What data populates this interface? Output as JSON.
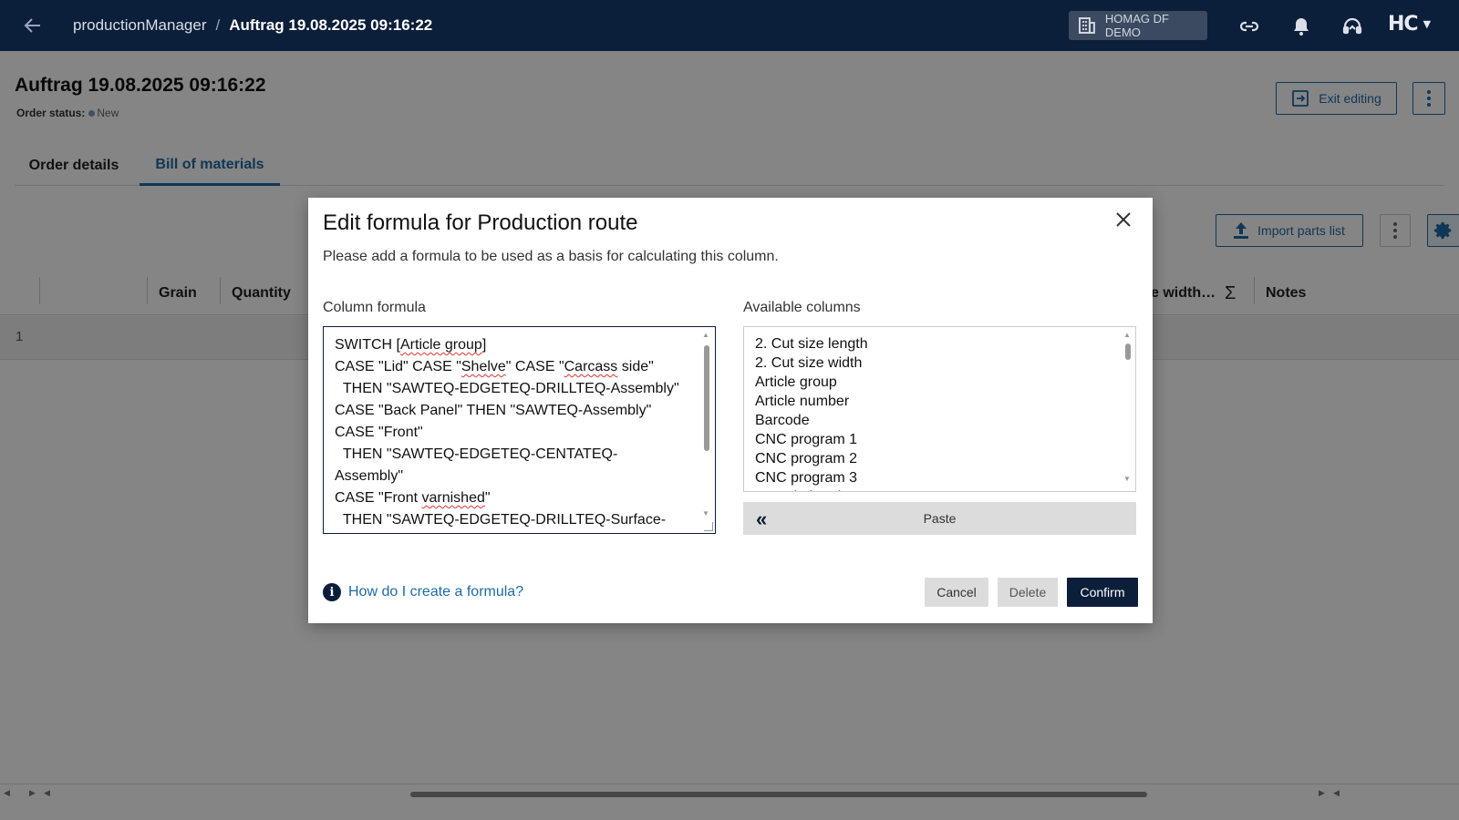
{
  "topbar": {
    "app_name": "productionManager",
    "separator": "/",
    "current": "Auftrag 19.08.2025 09:16:22",
    "tenant": "HOMAG DF DEMO",
    "logo": "HC"
  },
  "page": {
    "title": "Auftrag 19.08.2025 09:16:22",
    "status_label": "Order status:",
    "status_value": "New",
    "exit_editing": "Exit editing"
  },
  "tabs": [
    "Order details",
    "Bill of materials"
  ],
  "toolbar": {
    "import": "Import parts list"
  },
  "table": {
    "headers": {
      "grain": "Grain",
      "quantity": "Quantity",
      "cut_width": "e width…",
      "sum_icon": "Σ",
      "notes": "Notes"
    },
    "rows": [
      {
        "num": "1"
      }
    ]
  },
  "modal": {
    "title": "Edit formula for Production route",
    "subtitle": "Please add a formula to be used as a basis for calculating this column.",
    "formula_label": "Column formula",
    "formula_lines": [
      "SWITCH [Article group]",
      "CASE \"Lid\" CASE \"Shelve\" CASE \"Carcass side\"",
      "  THEN \"SAWTEQ-EDGETEQ-DRILLTEQ-Assembly\"",
      "CASE \"Back Panel\" THEN \"SAWTEQ-Assembly\"",
      "CASE \"Front\"",
      "  THEN \"SAWTEQ-EDGETEQ-CENTATEQ-",
      "Assembly\"",
      "CASE \"Front varnished\"",
      "  THEN \"SAWTEQ-EDGETEQ-DRILLTEQ-Surface-"
    ],
    "columns_label": "Available columns",
    "columns": [
      "2. Cut size length",
      "2. Cut size width",
      "Article group",
      "Article number",
      "Barcode",
      "CNC program 1",
      "CNC program 2",
      "CNC program 3",
      "Completion date"
    ],
    "paste": "Paste",
    "help": "How do I create a formula?",
    "cancel": "Cancel",
    "delete": "Delete",
    "confirm": "Confirm"
  },
  "icons": {
    "back": "arrow-left-icon",
    "link": "link-icon",
    "bell": "bell-icon",
    "support": "headset-icon",
    "close": "close-icon",
    "info": "info-icon"
  },
  "colors": {
    "navy": "#0b1e3a",
    "accent": "#1f6aa5"
  }
}
